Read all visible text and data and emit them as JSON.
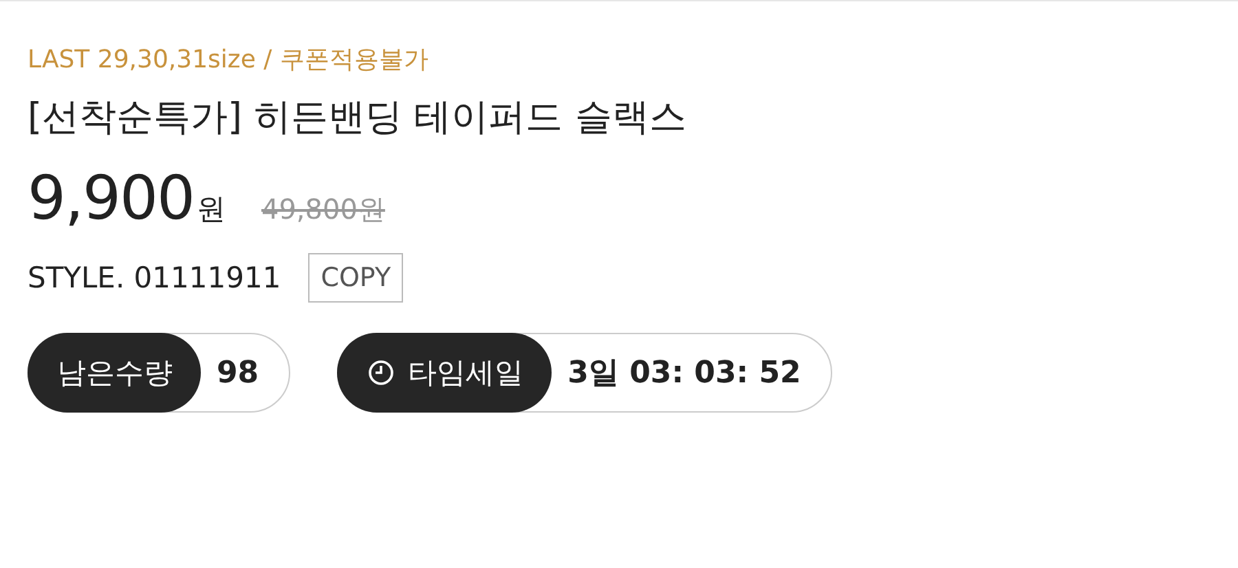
{
  "notice": "LAST 29,30,31size / 쿠폰적용불가",
  "title": "[선착순특가] 히든밴딩 테이퍼드 슬랙스",
  "price": {
    "amount": "9,900",
    "unit": "원",
    "original": "49,800원"
  },
  "style": {
    "label": "STYLE. 01111911",
    "copy_button": "COPY"
  },
  "badges": [
    {
      "kind": "stock",
      "label": "남은수량",
      "value": "98"
    },
    {
      "kind": "timer",
      "label": "타임세일",
      "value": "3일 03: 03: 52"
    }
  ]
}
